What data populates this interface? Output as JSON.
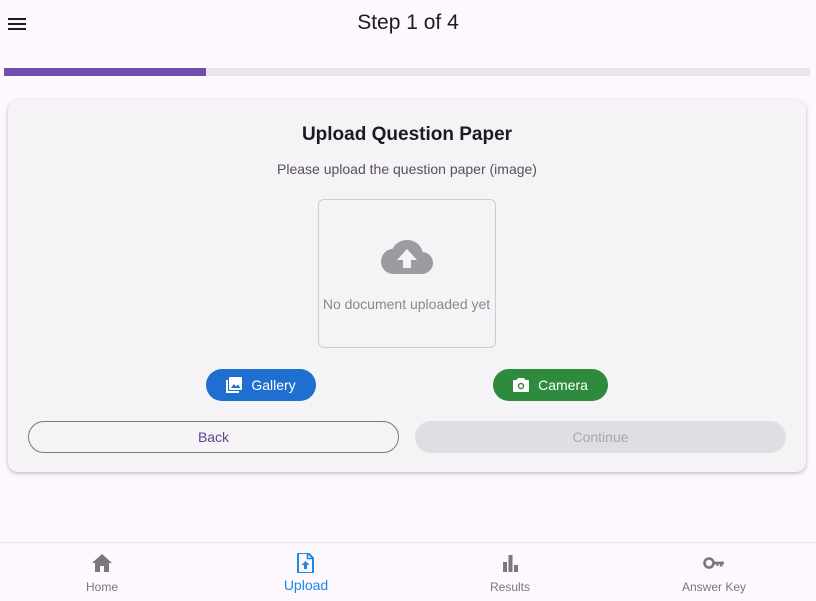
{
  "appbar": {
    "title": "Step 1 of 4",
    "menu_icon": "menu-icon"
  },
  "progress": {
    "current_step": 1,
    "total_steps": 4,
    "fraction": 0.25,
    "color": "#6e4fb0"
  },
  "card": {
    "title": "Upload Question Paper",
    "subtitle": "Please upload the question paper (image)",
    "upload_box": {
      "icon": "cloud-upload-icon",
      "empty_text": "No document uploaded yet"
    },
    "gallery_button": {
      "label": "Gallery",
      "icon": "photo-library-icon",
      "color": "#1e6fd0"
    },
    "camera_button": {
      "label": "Camera",
      "icon": "camera-icon",
      "color": "#2e8a3c"
    },
    "back_button": {
      "label": "Back"
    },
    "continue_button": {
      "label": "Continue",
      "enabled": false
    }
  },
  "bottom_nav": {
    "active_color": "#1e88e5",
    "items": [
      {
        "label": "Home",
        "icon": "home-icon",
        "active": false
      },
      {
        "label": "Upload",
        "icon": "upload-file-icon",
        "active": true
      },
      {
        "label": "Results",
        "icon": "bar-chart-icon",
        "active": false
      },
      {
        "label": "Answer Key",
        "icon": "key-icon",
        "active": false
      }
    ]
  }
}
